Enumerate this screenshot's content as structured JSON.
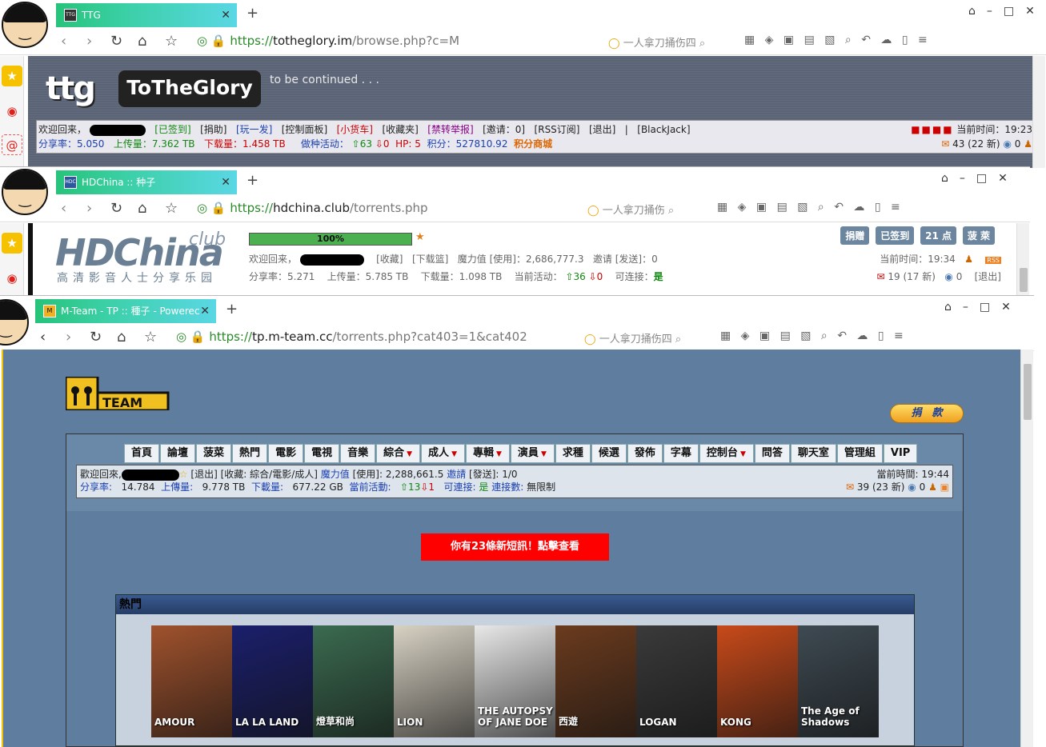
{
  "ttg": {
    "tab_title": "TTG",
    "favicon": "TTG",
    "url_scheme": "https://",
    "url_domain": "totheglory.im",
    "url_path": "/browse.php?c=M",
    "search_placeholder": "一人拿刀捅伤四",
    "logo_short": "ttg",
    "logo_full": "ToTheGlory",
    "tagline": "to be continued . . .",
    "line1": {
      "welcome": "欢迎回来，",
      "checked_in": "[已签到]",
      "donate": "[捐助]",
      "play": "[玩一发]",
      "control": "[控制面板]",
      "truck": "[小货车]",
      "favorites": "[收藏夹]",
      "report": "[禁转举报]",
      "invite": "[邀请：0]",
      "rss": "[RSS订阅]",
      "logout": "[退出]",
      "sep": "|",
      "blackjack": "[BlackJack]",
      "time": "当前时间：19:23"
    },
    "line2": {
      "ratio": "分享率：5.050",
      "upload": "上传量：7.362 TB",
      "download": "下载量：1.458 TB",
      "active_label": "做种活动：",
      "seeding": "⇧63",
      "leeching": "⇩0",
      "hp": "HP: 5",
      "points": "积分：527810.92",
      "shop": "积分商城",
      "messages": "43 (22 新)",
      "extra": "0"
    }
  },
  "hdc": {
    "tab_title": "HDChina :: 种子",
    "favicon": "HDC",
    "url_scheme": "https://",
    "url_domain": "hdchina.club",
    "url_path": "/torrents.php",
    "search_placeholder": "一人拿刀捅伤",
    "logo": "HDChina",
    "logo_club": "club",
    "logo_sub": "高清影音人士分享乐园",
    "progress": 1.0,
    "progress_label": "100%",
    "line1": {
      "welcome": "欢迎回来，",
      "fav": "[收藏]",
      "dlbox": "[下载篮]",
      "magic": "魔力值 [使用]：2,686,777.3",
      "invite": "邀请 [发送]：0",
      "time": "当前时间：19:34",
      "rss": "RSS"
    },
    "line2": {
      "ratio": "分享率：5.271",
      "upload": "上传量：5.785 TB",
      "download": "下载量：1.098 TB",
      "active": "当前活动：",
      "seeding": "⇧36",
      "leeching": "⇩0",
      "connectable": "可连接：",
      "connectable_val": "是",
      "messages": "19 (17 新)",
      "extra": "0",
      "logout": "[退出]"
    },
    "buttons": [
      "捐赠",
      "已签到",
      "21 点",
      "菠 萊"
    ]
  },
  "mt": {
    "tab_title": "M-Team - TP :: 種子 - Powerec",
    "favicon": "M",
    "url_scheme": "https://",
    "url_domain": "tp.m-team.cc",
    "url_path": "/torrents.php?cat403=1&cat402",
    "search_placeholder": "一人拿刀捅伤四",
    "logo": "M-TEAM",
    "donate": "捐　款",
    "menu": [
      {
        "label": "首頁",
        "drop": false
      },
      {
        "label": "論壇",
        "drop": false
      },
      {
        "label": "菠菜",
        "drop": false
      },
      {
        "label": "熱門",
        "drop": false
      },
      {
        "label": "電影",
        "drop": false
      },
      {
        "label": "電視",
        "drop": false
      },
      {
        "label": "音樂",
        "drop": false
      },
      {
        "label": "綜合",
        "drop": true
      },
      {
        "label": "成人",
        "drop": true
      },
      {
        "label": "專輯",
        "drop": true
      },
      {
        "label": "演員",
        "drop": true
      },
      {
        "label": "求種",
        "drop": false
      },
      {
        "label": "候選",
        "drop": false
      },
      {
        "label": "發佈",
        "drop": false
      },
      {
        "label": "字幕",
        "drop": false
      },
      {
        "label": "控制台",
        "drop": true
      },
      {
        "label": "問答",
        "drop": false
      },
      {
        "label": "聊天室",
        "drop": false
      },
      {
        "label": "管理組",
        "drop": false
      },
      {
        "label": "VIP",
        "drop": false
      }
    ],
    "line1": {
      "welcome": "歡迎回來,",
      "logout": "[退出]",
      "fav": "[收藏: 綜合/電影/成人]",
      "magic_label": "魔力值",
      "magic": "[使用]: 2,288,661.5",
      "invite_label": "邀請",
      "invite": "[發送]: 1/0",
      "time": "當前時間: 19:44"
    },
    "line2": {
      "ratio_label": "分享率:",
      "ratio": "14.784",
      "upload_label": "上傳量:",
      "upload": "9.778 TB",
      "download_label": "下載量:",
      "download": "677.22 GB",
      "active_label": "當前活動:",
      "seeding": "⇧13",
      "leeching": "⇩1",
      "connectable_label": "可連接:",
      "connectable": "是",
      "connections_label": "連接數:",
      "connections": "無限制",
      "messages": "39 (23 新)",
      "extra": "0"
    },
    "notice": "你有23條新短訊！點擊查看",
    "hot_title": "熱門",
    "posters": [
      {
        "title": "AMOUR",
        "color": "#a0522d"
      },
      {
        "title": "LA LA LAND",
        "color": "#1b1f6b"
      },
      {
        "title": "燈草和尚",
        "color": "#3b6b50"
      },
      {
        "title": "LION",
        "color": "#d8d2c4"
      },
      {
        "title": "THE AUTOPSY OF JANE DOE",
        "color": "#e8e8e8"
      },
      {
        "title": "西遊",
        "color": "#6b3b1e"
      },
      {
        "title": "LOGAN",
        "color": "#3a3a3a"
      },
      {
        "title": "KONG",
        "color": "#c84a1a"
      },
      {
        "title": "The Age of Shadows",
        "color": "#3e4a52"
      }
    ]
  },
  "colors": {
    "tab_gradient_start": "#27c37a",
    "tab_gradient_end": "#5ad7e4",
    "ttg_bg": "#5b6476",
    "mteam_bg": "#5f7d9e",
    "notice_red": "#ff0000"
  }
}
